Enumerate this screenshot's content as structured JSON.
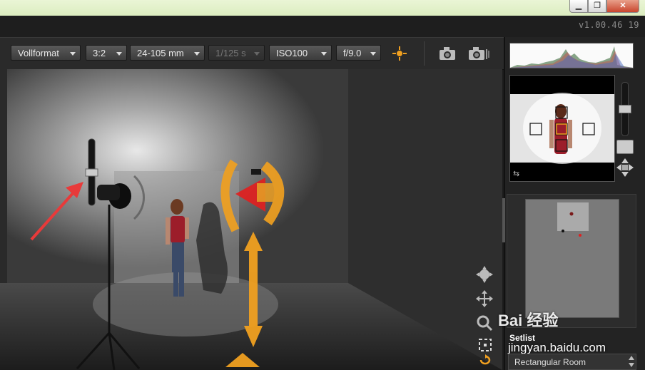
{
  "window": {
    "minimize_glyph": "▁",
    "maximize_glyph": "❐",
    "close_glyph": "✕",
    "version": "v1.00.46  19"
  },
  "toolbar": {
    "format": "Vollformat",
    "ratio": "3:2",
    "lens": "24-105 mm",
    "shutter": "1/125 s",
    "iso": "ISO100",
    "aperture": "f/9.0",
    "icons": [
      "focus-target-icon",
      "camera-icon",
      "camera-series-icon"
    ]
  },
  "side_panel": {
    "setlist_label": "Setlist",
    "setlist_value": "Rectangular Room"
  },
  "watermark": {
    "brand": "Bai 经验",
    "url": "jingyan.baidu.com"
  },
  "colors": {
    "accent_orange": "#f0a020",
    "handle_red": "#e02020",
    "annotation_arrow": "#e83a3a"
  }
}
